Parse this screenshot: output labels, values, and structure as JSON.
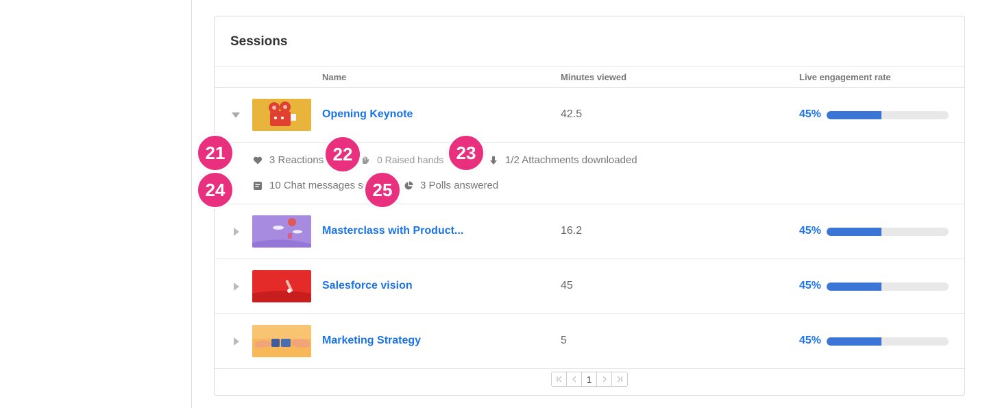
{
  "section": {
    "title": "Sessions"
  },
  "columns": {
    "name": "Name",
    "minutes": "Minutes viewed",
    "engagement": "Live engagement rate"
  },
  "sessions": [
    {
      "name": "Opening Keynote",
      "minutes": "42.5",
      "engagement": "45%",
      "engagement_value": 0.45,
      "expanded": true
    },
    {
      "name": "Masterclass with Product...",
      "minutes": "16.2",
      "engagement": "45%",
      "engagement_value": 0.45,
      "expanded": false
    },
    {
      "name": "Salesforce vision",
      "minutes": "45",
      "engagement": "45%",
      "engagement_value": 0.45,
      "expanded": false
    },
    {
      "name": "Marketing Strategy",
      "minutes": "5",
      "engagement": "45%",
      "engagement_value": 0.45,
      "expanded": false
    }
  ],
  "details": {
    "reactions": "3 Reactions",
    "raised_hands": "0 Raised hands",
    "attachments": "1/2 Attachments downloaded",
    "chat": "10 Chat messages sent",
    "polls": "3 Polls answered"
  },
  "callouts": [
    "21",
    "22",
    "23",
    "24",
    "25"
  ],
  "pagination": {
    "current": "1"
  },
  "colors": {
    "accent": "#1a73e8",
    "bar": "#3b76d6",
    "badge": "#e8307f"
  }
}
